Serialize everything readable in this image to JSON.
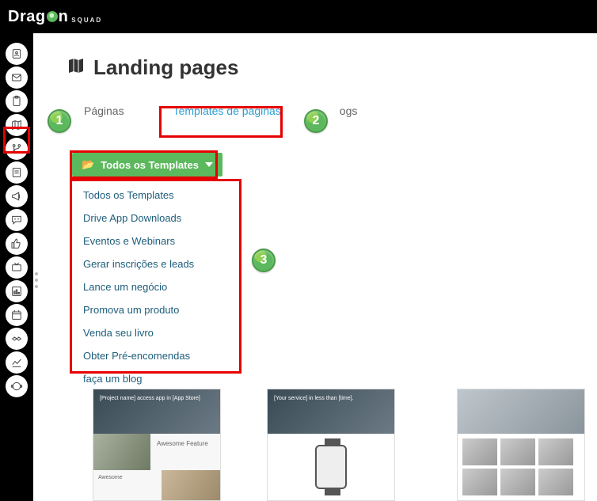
{
  "brand": {
    "main": "Drag",
    "suffix": "n",
    "sub": "SQUAD"
  },
  "page": {
    "title": "Landing pages"
  },
  "tabs": {
    "paginas": "Páginas",
    "templates": "Templates de páginas",
    "blogs": "ogs"
  },
  "dropdown": {
    "label": "Todos os Templates"
  },
  "menu": {
    "items": [
      "Todos os Templates",
      "Drive App Downloads",
      "Eventos e Webinars",
      "Gerar inscrições e leads",
      "Lance um negócio",
      "Promova um produto",
      "Venda seu livro",
      "Obter Pré-encomendas",
      "faça um blog"
    ]
  },
  "callouts": {
    "c1": "1",
    "c2": "2",
    "c3": "3"
  },
  "sidebar": {
    "items": [
      "contact-icon",
      "mail-icon",
      "clipboard-icon",
      "map-icon",
      "branch-icon",
      "form-icon",
      "megaphone-icon",
      "chat-icon",
      "thumb-icon",
      "tv-icon",
      "report-icon",
      "event-icon",
      "deal-icon",
      "analytics-icon",
      "support-icon"
    ]
  },
  "templates": {
    "t1": {
      "hero": "[Project name] access app in [App Store]",
      "featureTitle": "Awesome Feature",
      "footer": "Awesome"
    },
    "t2": {
      "hero": "[Your service] in less than [time]."
    },
    "t3": {
      "hero": ""
    }
  }
}
